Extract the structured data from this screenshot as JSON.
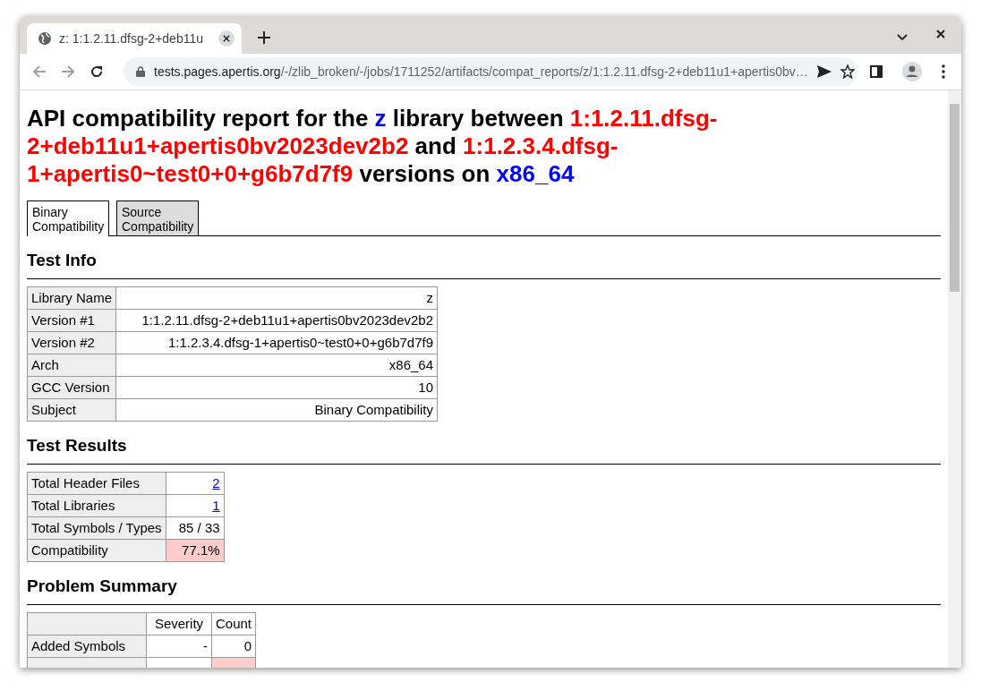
{
  "browser": {
    "tab_title": "z: 1:1.2.11.dfsg-2+deb11u",
    "url_host": "tests.pages.apertis.org",
    "url_path": "/-/zlib_broken/-/jobs/1711252/artifacts/compat_reports/z/1:1.2.11.dfsg-2+deb11u1+apertis0bv…"
  },
  "title": [
    {
      "text": "API compatibility report for the ",
      "kind": "plain"
    },
    {
      "text": "z",
      "kind": "name"
    },
    {
      "text": " library between ",
      "kind": "plain"
    },
    {
      "text": "1:1.2.11.dfsg-2+deb11u1+apertis0bv2023dev2b2",
      "kind": "version"
    },
    {
      "text": " and ",
      "kind": "plain"
    },
    {
      "text": "1:1.2.3.4.dfsg-1+apertis0~test0+0+g6b7d7f9",
      "kind": "version"
    },
    {
      "text": " versions on ",
      "kind": "plain"
    },
    {
      "text": "x86_64",
      "kind": "name"
    }
  ],
  "tabs": [
    {
      "label": "Binary Compatibility",
      "selected": true
    },
    {
      "label": "Source Compatibility",
      "selected": false
    }
  ],
  "test_info": {
    "heading": "Test Info",
    "rows": [
      {
        "label": "Library Name",
        "value": "z"
      },
      {
        "label": "Version #1",
        "value": "1:1.2.11.dfsg-2+deb11u1+apertis0bv2023dev2b2"
      },
      {
        "label": "Version #2",
        "value": "1:1.2.3.4.dfsg-1+apertis0~test0+0+g6b7d7f9"
      },
      {
        "label": "Arch",
        "value": "x86_64"
      },
      {
        "label": "GCC Version",
        "value": "10"
      },
      {
        "label": "Subject",
        "value": "Binary Compatibility"
      }
    ]
  },
  "test_results": {
    "heading": "Test Results",
    "rows": [
      {
        "label": "Total Header Files",
        "value": "2",
        "kind": "link",
        "highlight": false
      },
      {
        "label": "Total Libraries",
        "value": "1",
        "kind": "link",
        "highlight": false
      },
      {
        "label": "Total Symbols / Types",
        "value": "85 / 33",
        "kind": "text",
        "highlight": false
      },
      {
        "label": "Compatibility",
        "value": "77.1%",
        "kind": "text",
        "highlight": true
      }
    ]
  },
  "problem_summary": {
    "heading": "Problem Summary",
    "columns": [
      "Severity",
      "Count"
    ],
    "rows": [
      {
        "label": "Added Symbols",
        "severity": "-",
        "count": "0",
        "highlight": false
      },
      {
        "highlight": true
      }
    ]
  }
}
